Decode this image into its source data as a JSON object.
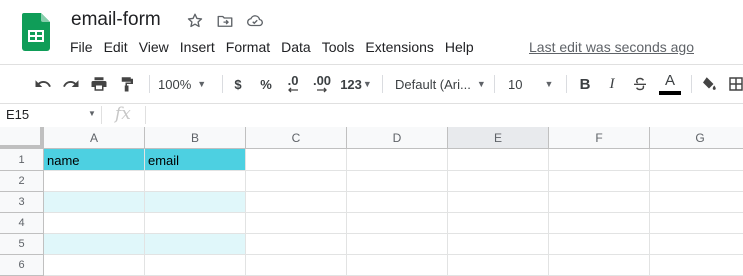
{
  "app": {
    "title": "email-form",
    "last_edit": "Last edit was seconds ago",
    "menu": [
      "File",
      "Edit",
      "View",
      "Insert",
      "Format",
      "Data",
      "Tools",
      "Extensions",
      "Help"
    ]
  },
  "toolbar": {
    "zoom": "100%",
    "currency": "$",
    "percent": "%",
    "decrease_decimal": ".0",
    "increase_decimal": ".00",
    "number_format": "123",
    "font": "Default (Ari...",
    "font_size": "10",
    "bold": "B",
    "italic": "I",
    "text_color_letter": "A",
    "text_color": "#000000"
  },
  "formula_bar": {
    "name_box": "E15",
    "fx": "fx",
    "value": ""
  },
  "sheet": {
    "columns": [
      "A",
      "B",
      "C",
      "D",
      "E",
      "F",
      "G"
    ],
    "selected_column": "E",
    "rows": [
      "1",
      "2",
      "3",
      "4",
      "5",
      "6"
    ],
    "cells": {
      "A1": "name",
      "B1": "email"
    },
    "header_color": "#4dd0e1",
    "band_color": "#e0f7fa"
  }
}
